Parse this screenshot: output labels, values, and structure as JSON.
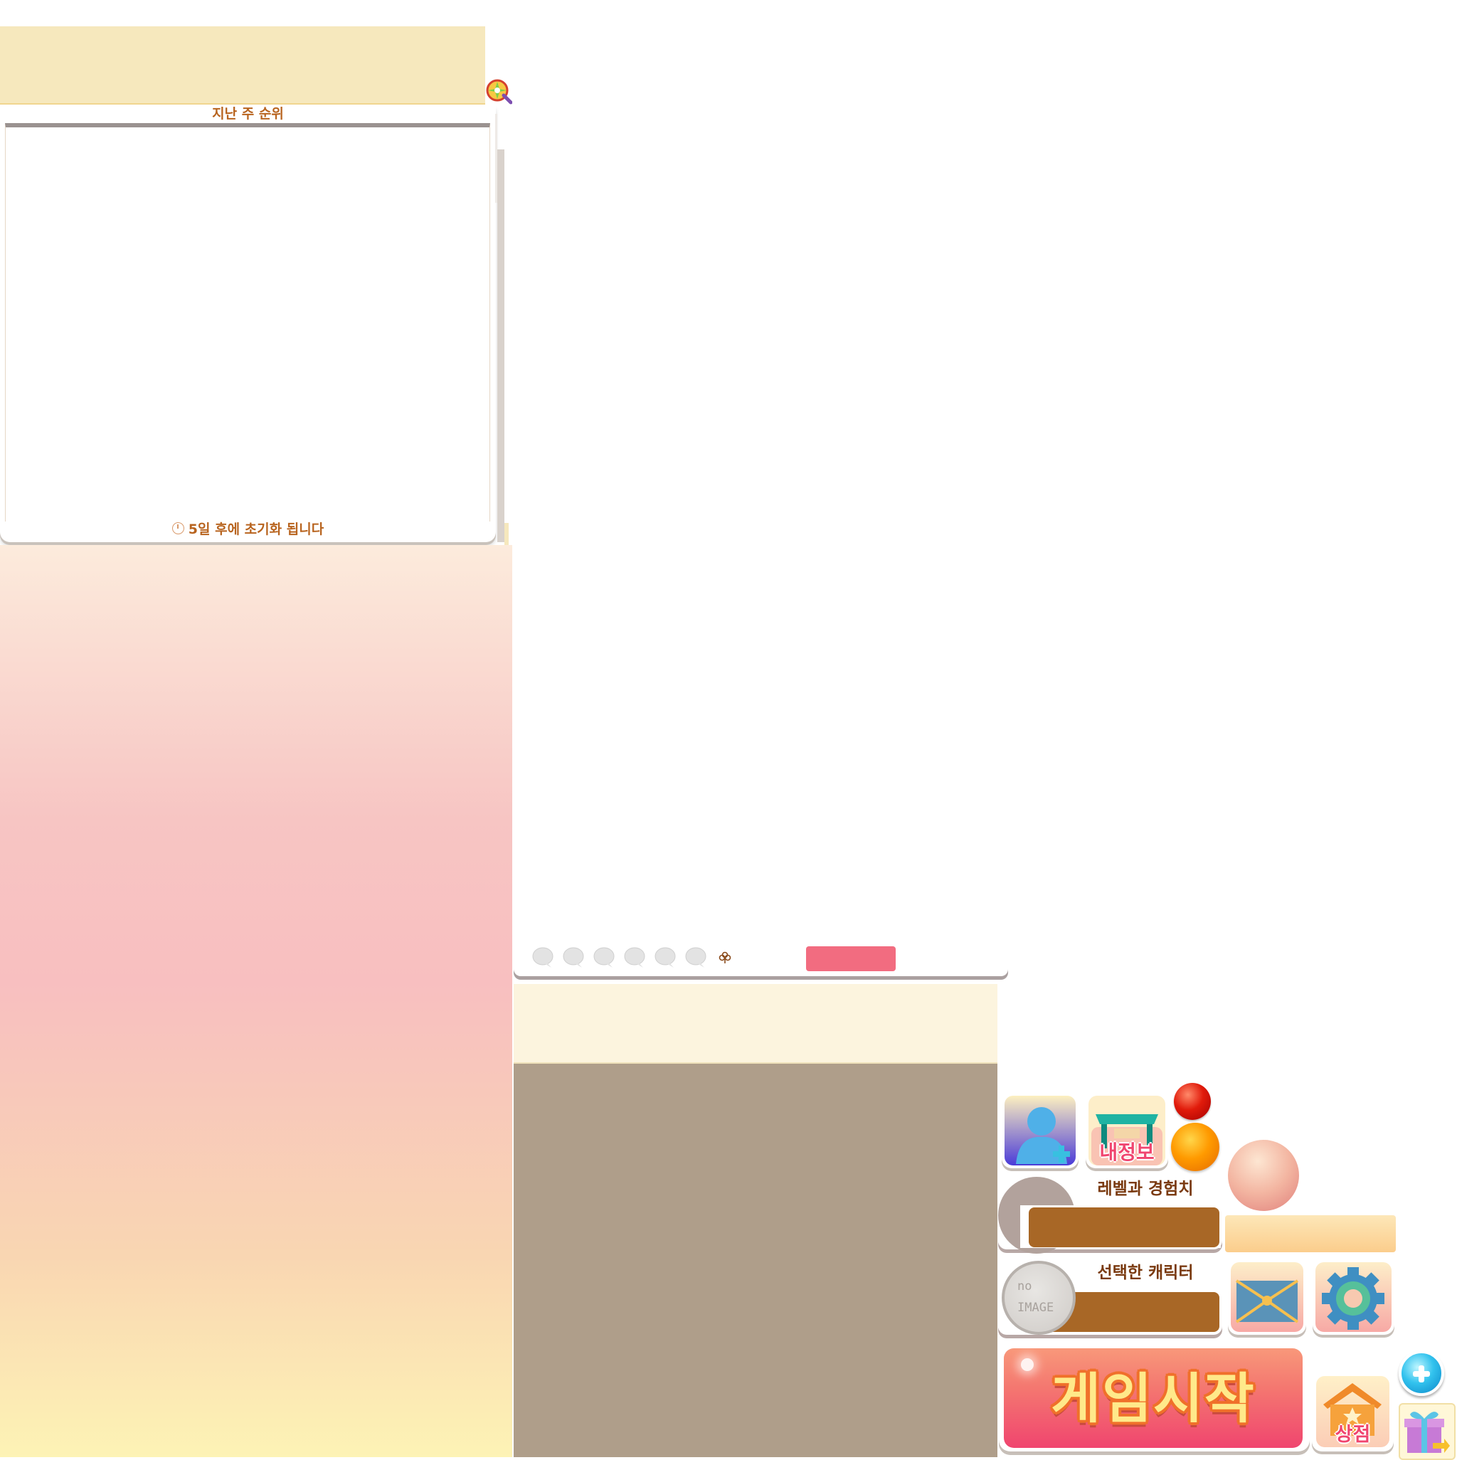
{
  "ranking": {
    "title": "지난 주 순위",
    "reset_notice": "5일 후에 초기화 됩니다"
  },
  "hud": {
    "my_info_label": "내정보",
    "level_label": "레벨과 경험치",
    "selected_character_label": "선택한 캐릭터",
    "no_image_line1": "no",
    "no_image_line2": "IMAGE",
    "start_label": "게임시작",
    "shop_label": "상점"
  },
  "icons": {
    "lollipop": "lollipop-icon",
    "bubbles": "chat-bubble-icon",
    "clover": "clover-icon",
    "friend": "add-friend-icon",
    "myinfo": "desk-icon",
    "mail": "envelope-icon",
    "settings": "gear-icon",
    "shop": "house-star-icon",
    "plus": "plus-icon",
    "gift": "gift-icon"
  },
  "colors": {
    "accent_brown": "#a86726",
    "start_pink": "#f0456f",
    "label_brown": "#b8641f"
  }
}
